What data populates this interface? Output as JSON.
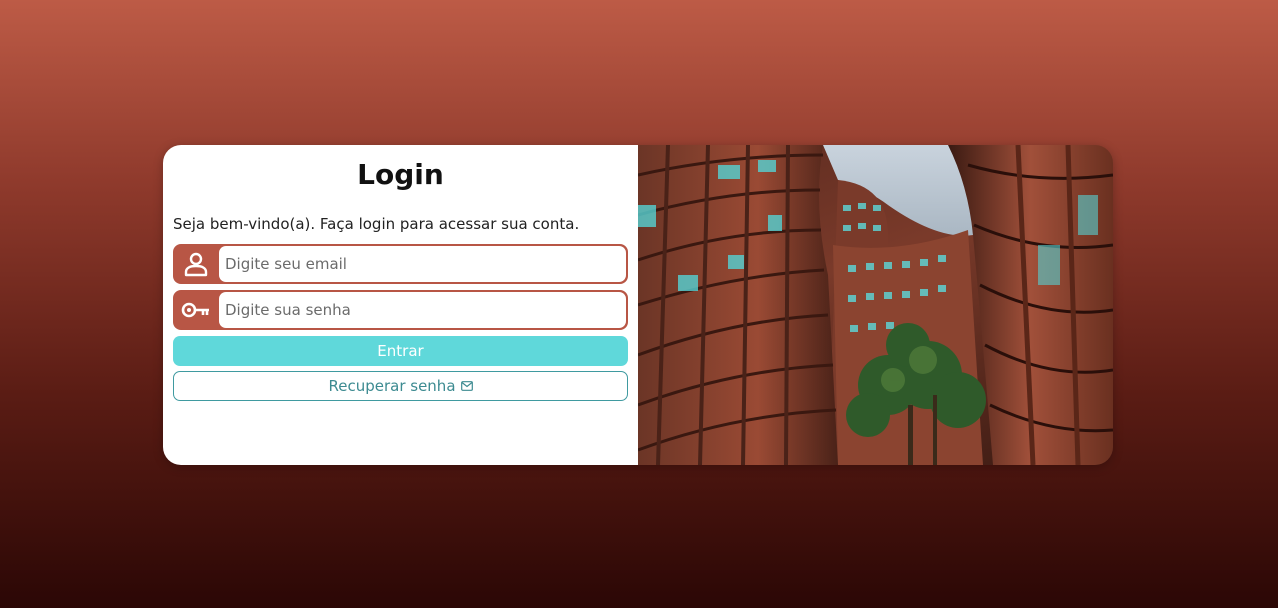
{
  "login": {
    "title": "Login",
    "welcome": "Seja bem-vindo(a). Faça login para acessar sua conta.",
    "email_placeholder": "Digite seu email",
    "password_placeholder": "Digite sua senha",
    "submit_label": "Entrar",
    "recover_label": "Recuperar senha"
  },
  "icons": {
    "email_field": "user-icon",
    "password_field": "key-icon",
    "recover": "mail-icon"
  },
  "colors": {
    "accent": "#b85645",
    "submit": "#5fd8da",
    "recover_border": "#3f9aa0"
  }
}
